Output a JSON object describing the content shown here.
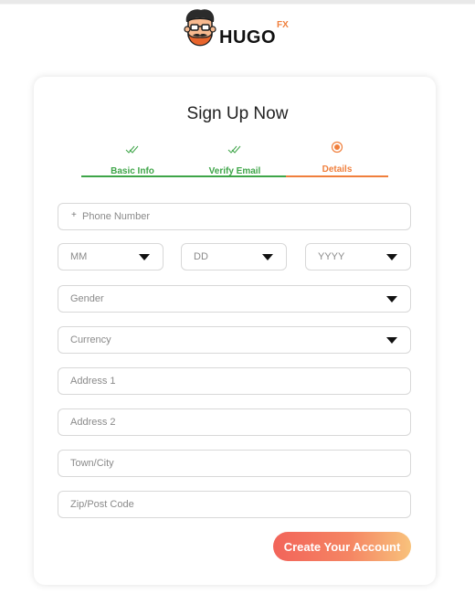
{
  "brand": {
    "name": "HUGO",
    "superscript": "FX"
  },
  "form": {
    "title": "Sign Up Now",
    "steps": [
      {
        "label": "Basic Info",
        "status": "done",
        "icon": "double-check-icon"
      },
      {
        "label": "Verify Email",
        "status": "done",
        "icon": "double-check-icon"
      },
      {
        "label": "Details",
        "status": "active",
        "icon": "radio-dot-icon"
      }
    ],
    "fields": {
      "phone": {
        "prefix": "+",
        "placeholder": "Phone Number",
        "value": ""
      },
      "dob_month": {
        "placeholder": "MM"
      },
      "dob_day": {
        "placeholder": "DD"
      },
      "dob_year": {
        "placeholder": "YYYY"
      },
      "gender": {
        "placeholder": "Gender"
      },
      "currency": {
        "placeholder": "Currency"
      },
      "address1": {
        "placeholder": "Address 1",
        "value": ""
      },
      "address2": {
        "placeholder": "Address 2",
        "value": ""
      },
      "town": {
        "placeholder": "Town/City",
        "value": ""
      },
      "zip": {
        "placeholder": "Zip/Post Code",
        "value": ""
      }
    },
    "submit_label": "Create Your Account"
  },
  "colors": {
    "done": "#3ea548",
    "active": "#f07f3c",
    "button_gradient": [
      "#f2645a",
      "#f8c27c"
    ]
  }
}
